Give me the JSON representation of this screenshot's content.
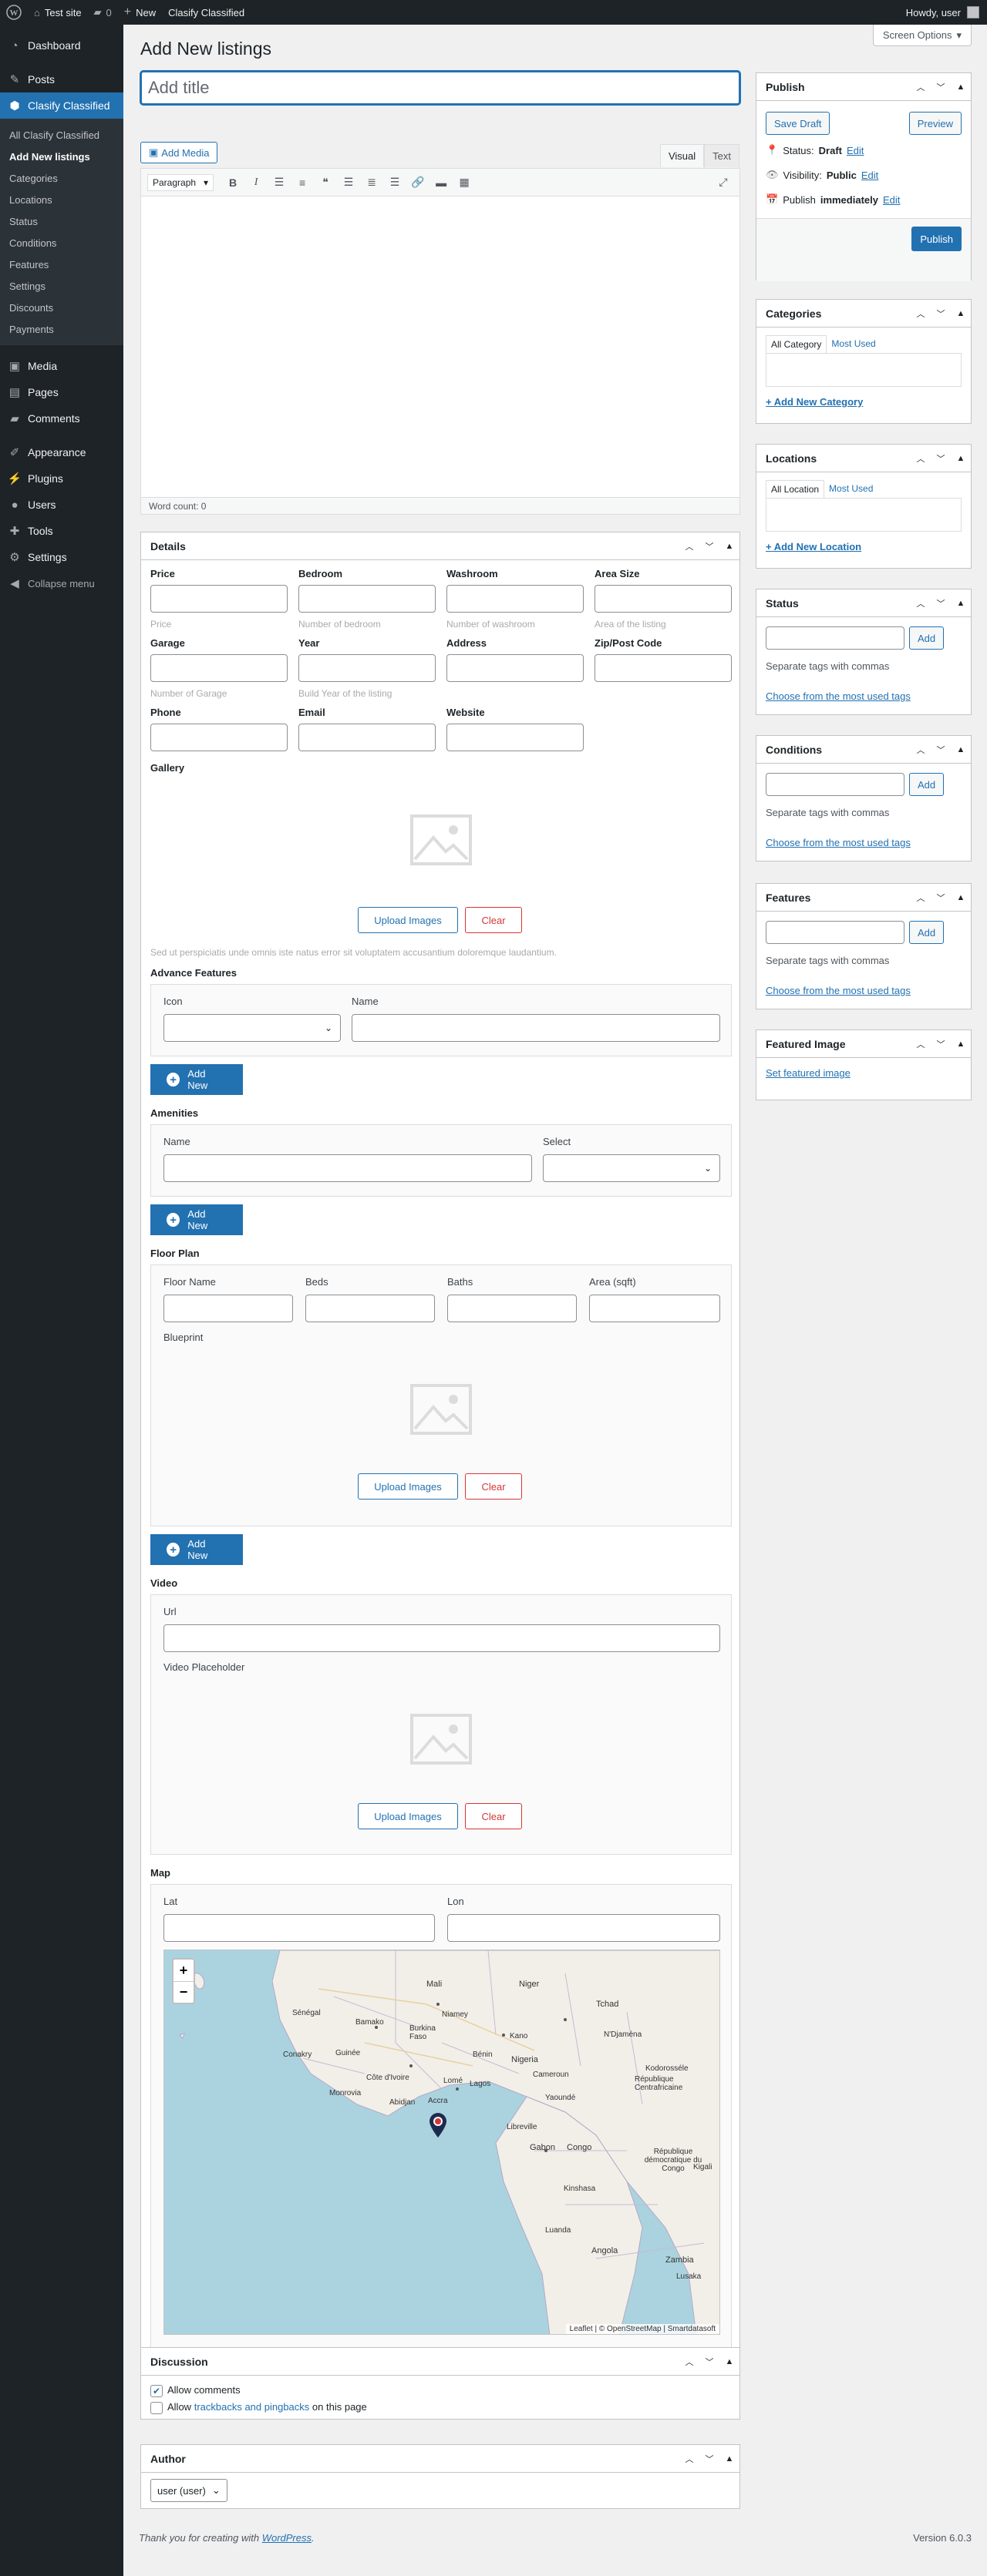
{
  "adminbar": {
    "site_name": "Test site",
    "comments_count": "0",
    "new_label": "New",
    "plugin_label": "Clasify Classified",
    "howdy": "Howdy, user"
  },
  "sidebar": {
    "items": [
      {
        "label": "Dashboard",
        "icon": "dashboard-icon"
      },
      {
        "label": "Posts",
        "icon": "pushpin-icon"
      },
      {
        "label": "Clasify Classified",
        "icon": "shield-icon"
      },
      {
        "label": "Media",
        "icon": "media-icon"
      },
      {
        "label": "Pages",
        "icon": "page-icon"
      },
      {
        "label": "Comments",
        "icon": "comment-icon"
      },
      {
        "label": "Appearance",
        "icon": "brush-icon"
      },
      {
        "label": "Plugins",
        "icon": "plug-icon"
      },
      {
        "label": "Users",
        "icon": "user-icon"
      },
      {
        "label": "Tools",
        "icon": "wrench-icon"
      },
      {
        "label": "Settings",
        "icon": "settings-icon"
      }
    ],
    "submenu": [
      "All Clasify Classified",
      "Add New listings",
      "Categories",
      "Locations",
      "Status",
      "Conditions",
      "Features",
      "Settings",
      "Discounts",
      "Payments"
    ],
    "collapse": "Collapse menu"
  },
  "screen_options": "Screen Options",
  "page_title": "Add New listings",
  "title_placeholder": "Add title",
  "add_media": "Add Media",
  "editor": {
    "tab_visual": "Visual",
    "tab_text": "Text",
    "paragraph": "Paragraph",
    "word_count": "Word count: 0"
  },
  "details": {
    "title": "Details",
    "labels": {
      "price": "Price",
      "bedroom": "Bedroom",
      "washroom": "Washroom",
      "area_size": "Area Size",
      "garage": "Garage",
      "year": "Year",
      "address": "Address",
      "zip": "Zip/Post Code",
      "phone": "Phone",
      "email": "Email",
      "website": "Website",
      "gallery": "Gallery"
    },
    "descs": {
      "price": "Price",
      "bedroom": "Number of bedroom",
      "washroom": "Number of washroom",
      "area": "Area of the listing",
      "garage": "Number of Garage",
      "year": "Build Year of the listing"
    },
    "upload_images": "Upload Images",
    "clear": "Clear",
    "lorem": "Sed ut perspiciatis unde omnis iste natus error sit voluptatem accusantium doloremque laudantium.",
    "advance_features": "Advance Features",
    "icon_label": "Icon",
    "name_label": "Name",
    "add_new": "Add New",
    "amenities": "Amenities",
    "select_label": "Select",
    "floor_plan": "Floor Plan",
    "floor_name": "Floor Name",
    "beds": "Beds",
    "baths": "Baths",
    "area_sqft": "Area (sqft)",
    "blueprint": "Blueprint",
    "video": "Video",
    "url": "Url",
    "video_placeholder": "Video Placeholder",
    "map": "Map",
    "lat": "Lat",
    "lon": "Lon"
  },
  "map": {
    "attribution": "Leaflet | © OpenStreetMap | Smartdatasoft",
    "places": [
      "Mali",
      "Niger",
      "Tchad",
      "Sénégal",
      "Bamako",
      "Niamey",
      "Burkina Faso",
      "Kano",
      "N'Djaména",
      "Conakry",
      "Guinée",
      "Bénin",
      "Nigeria",
      "Côte d'Ivoire",
      "Lomé",
      "Lagos",
      "Kodorosséle",
      "Monrovia",
      "Abidjan",
      "Accra",
      "Cameroun",
      "République Centrafricaine",
      "Yaoundé",
      "Libreville",
      "Gabon",
      "Congo",
      "République démocratique du Congo",
      "Kigali",
      "Kinshasa",
      "Luanda",
      "Angola",
      "Zambia",
      "Lusaka"
    ]
  },
  "discussion": {
    "title": "Discussion",
    "allow_comments": "Allow comments",
    "allow_prefix": "Allow",
    "trackbacks_link": "trackbacks and pingbacks",
    "allow_suffix": "on this page"
  },
  "author": {
    "title": "Author",
    "selected": "user (user)"
  },
  "publish": {
    "title": "Publish",
    "save_draft": "Save Draft",
    "preview": "Preview",
    "status_label": "Status:",
    "status_value": "Draft",
    "visibility_label": "Visibility:",
    "visibility_value": "Public",
    "publish_label": "Publish",
    "publish_value": "immediately",
    "edit": "Edit",
    "publish_button": "Publish"
  },
  "categories": {
    "title": "Categories",
    "tab_all": "All Category",
    "tab_most": "Most Used",
    "add_new": "+ Add New Category"
  },
  "locations": {
    "title": "Locations",
    "tab_all": "All Location",
    "tab_most": "Most Used",
    "add_new": "+ Add New Location"
  },
  "tagboxes": [
    {
      "title": "Status",
      "add": "Add",
      "hint": "Separate tags with commas",
      "choose": "Choose from the most used tags"
    },
    {
      "title": "Conditions",
      "add": "Add",
      "hint": "Separate tags with commas",
      "choose": "Choose from the most used tags"
    },
    {
      "title": "Features",
      "add": "Add",
      "hint": "Separate tags with commas",
      "choose": "Choose from the most used tags"
    }
  ],
  "featured_image": {
    "title": "Featured Image",
    "link": "Set featured image"
  },
  "footer": {
    "thanks_prefix": "Thank you for creating with",
    "wordpress": "WordPress",
    "version": "Version 6.0.3"
  }
}
